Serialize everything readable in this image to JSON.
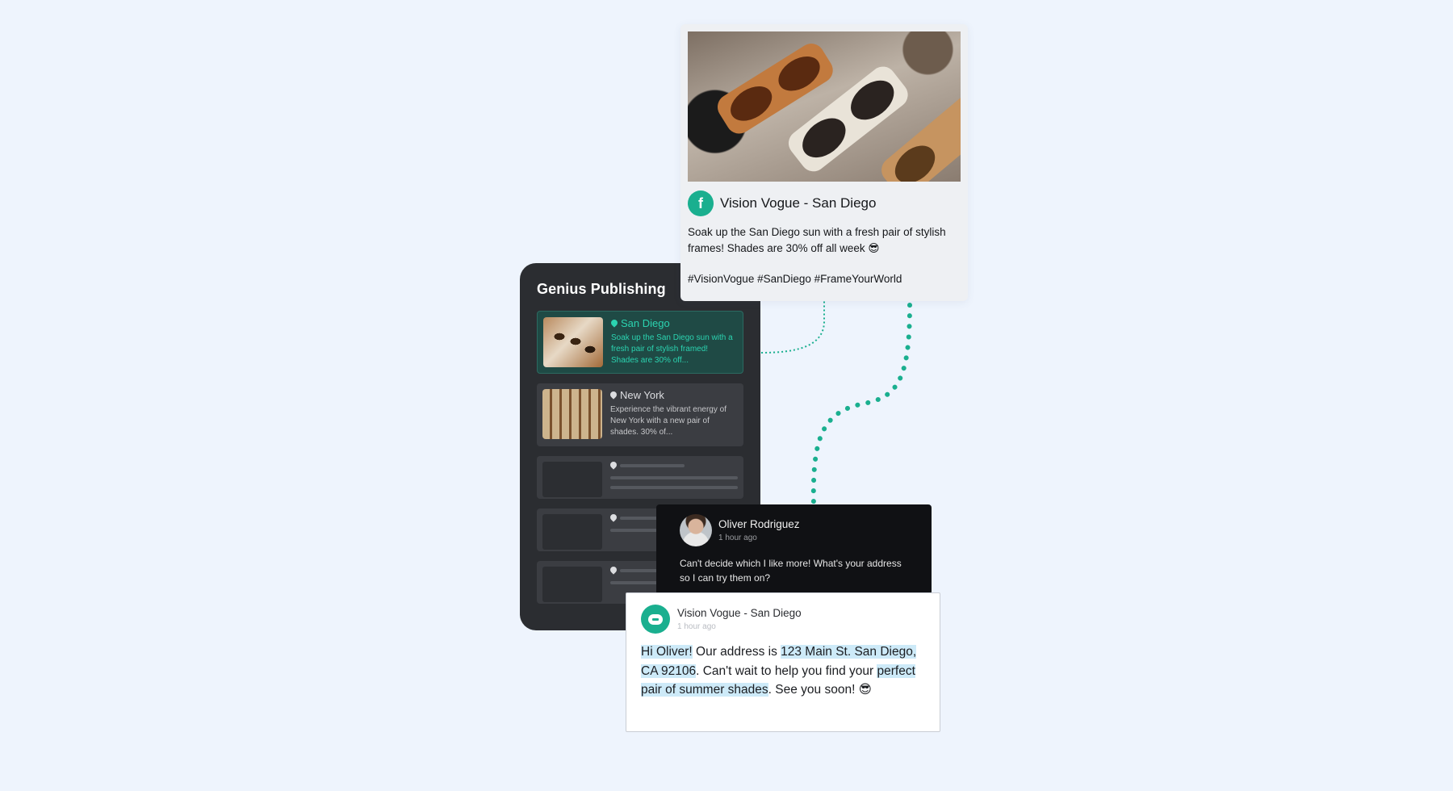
{
  "publishing": {
    "title": "Genius Publishing",
    "items": [
      {
        "location": "San Diego",
        "text": "Soak up the San Diego sun with a fresh pair of stylish framed! Shades are 30% off..."
      },
      {
        "location": "New York",
        "text": "Experience the vibrant energy of New York with a new pair of shades. 30% of..."
      }
    ]
  },
  "post": {
    "page_name": "Vision Vogue - San Diego",
    "text": "Soak up the San Diego sun with a fresh pair of stylish frames! Shades are 30% off all week 😎",
    "hashtags": "#VisionVogue #SanDiego #FrameYourWorld",
    "icon_letter": "f"
  },
  "comment": {
    "author": "Oliver Rodriguez",
    "time": "1 hour ago",
    "text": "Can't decide which I like more! What's your address so I can try them on?"
  },
  "reply": {
    "author": "Vision Vogue - San Diego",
    "time": "1 hour ago",
    "greeting": "Hi Oliver!",
    "part1": " Our address is ",
    "address": "123 Main St. San Diego, CA 92106",
    "part2": ". Can't wait to help you find your ",
    "highlight2": "perfect pair of summer shades",
    "part3": ". See you soon! 😎"
  },
  "colors": {
    "background": "#eef4fd",
    "accent": "#1aaf8f",
    "highlight": "#cdeaf8"
  }
}
